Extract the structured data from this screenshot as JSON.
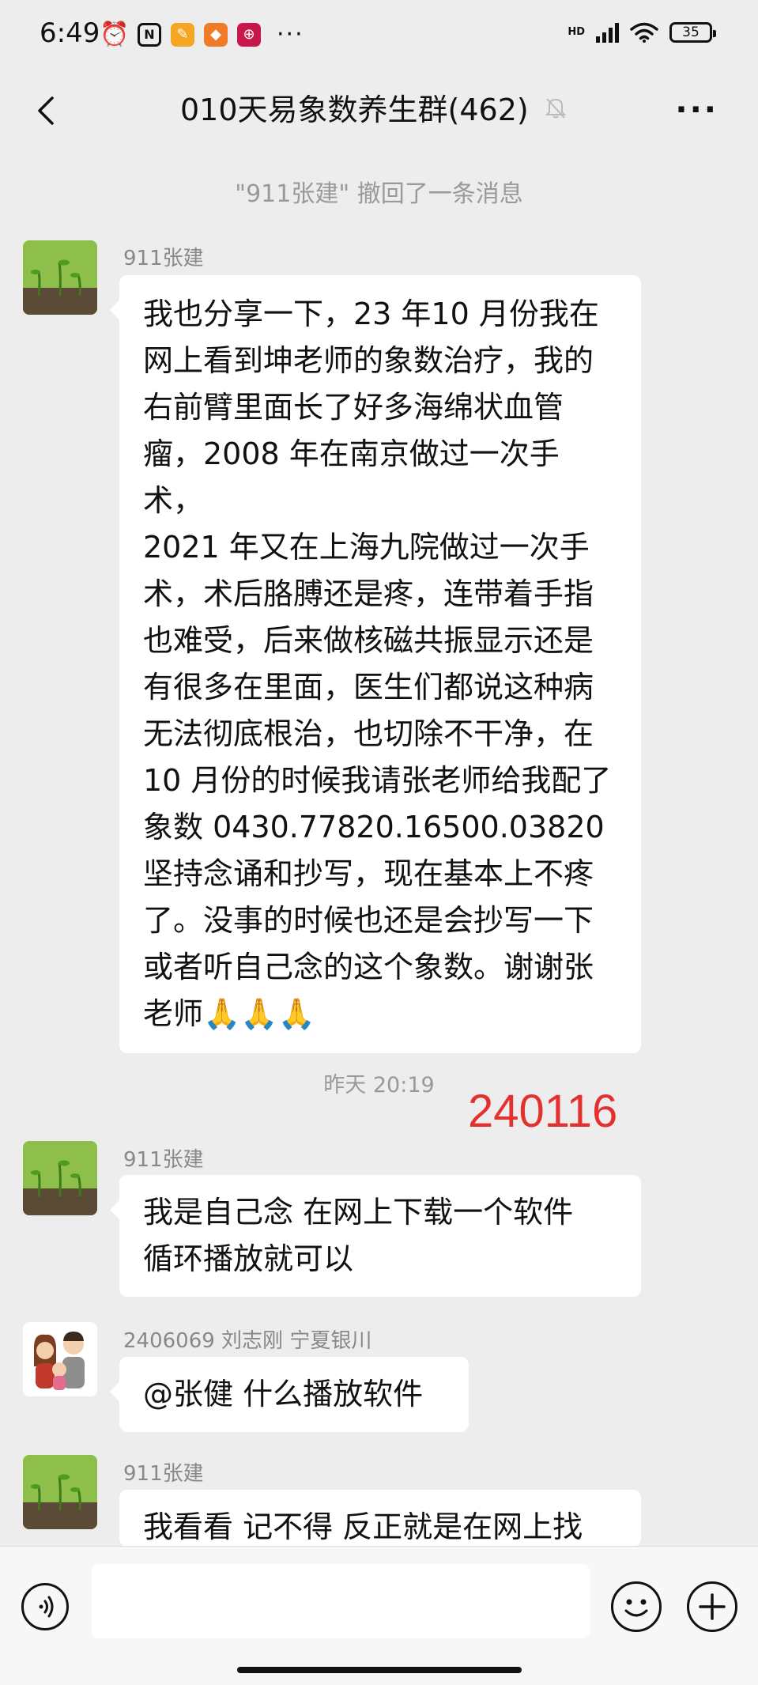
{
  "status_bar": {
    "time": "6:49",
    "battery": "35",
    "signal_label": "HD"
  },
  "header": {
    "title": "010天易象数养生群(462)"
  },
  "chat": {
    "system_message": "\"911张建\" 撤回了一条消息",
    "time_separator": "昨天 20:19",
    "stamp": "240116",
    "messages": [
      {
        "sender": "911张建",
        "lines": [
          "我也分享一下，23 年10 月份我在",
          "网上看到坤老师的象数治疗，我的",
          "右前臂里面长了好多海绵状血管",
          "瘤，2008 年在南京做过一次手术，",
          "2021 年又在上海九院做过一次手",
          "术，术后胳膊还是疼，连带着手指",
          "也难受，后来做核磁共振显示还是",
          "有很多在里面，医生们都说这种病",
          "无法彻底根治，也切除不干净，在",
          "10 月份的时候我请张老师给我配了",
          "象数 0430.77820.16500.03820",
          "坚持念诵和抄写，现在基本上不疼",
          "了。没事的时候也还是会抄写一下",
          "或者听自己念的这个象数。谢谢张",
          "老师🙏🙏🙏"
        ]
      },
      {
        "sender": "911张建",
        "lines": [
          "我是自己念 在网上下载一个软件",
          "循环播放就可以"
        ]
      },
      {
        "sender": "2406069 刘志刚 宁夏银川",
        "lines": [
          "@张健  什么播放软件"
        ]
      },
      {
        "sender": "911张建",
        "lines": [
          "我看看 记不得 反正就是在网上找"
        ]
      }
    ]
  },
  "colors": {
    "background": "#ededed",
    "bubble": "#ffffff",
    "stamp": "#e53030",
    "meta_text": "#999999"
  },
  "icons": [
    "back-arrow-icon",
    "mute-bell-icon",
    "more-dots-icon",
    "voice-icon",
    "emoji-icon",
    "plus-icon",
    "alarm-icon",
    "nfc-icon",
    "wifi-icon",
    "signal-icon",
    "battery-icon"
  ]
}
